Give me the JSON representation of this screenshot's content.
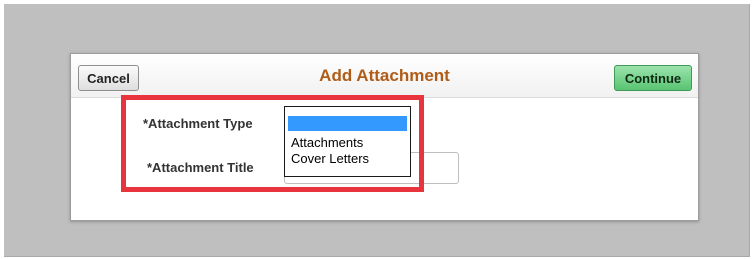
{
  "dialog": {
    "title": "Add Attachment",
    "cancel_label": "Cancel",
    "continue_label": "Continue"
  },
  "form": {
    "attachment_type_label": "*Attachment Type",
    "attachment_title_label": "*Attachment Title",
    "attachment_title_value": "",
    "attachment_type_options": [
      "",
      "Attachments",
      "Cover Letters"
    ],
    "attachment_type_selected": ""
  },
  "colors": {
    "title": "#b05c18",
    "continue_button": "#59c473",
    "selected_option": "#3399ff",
    "highlight_box": "#e8343c"
  }
}
